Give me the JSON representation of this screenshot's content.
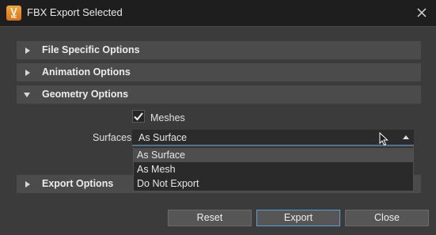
{
  "window": {
    "title": "FBX Export Selected",
    "app_icon_letter": "V",
    "app_icon_sub": "ME",
    "close_icon": "close-icon"
  },
  "sections": [
    {
      "label": "File Specific Options",
      "expanded": false
    },
    {
      "label": "Animation Options",
      "expanded": false
    },
    {
      "label": "Geometry Options",
      "expanded": true
    },
    {
      "label": "Export Options",
      "expanded": false
    }
  ],
  "geometry": {
    "meshes_label": "Meshes",
    "meshes_checked": true,
    "surfaces_label": "Surfaces",
    "surfaces_value": "As Surface",
    "surfaces_options": [
      "As Surface",
      "As Mesh",
      "Do Not Export"
    ],
    "selected_option_index": 0
  },
  "buttons": {
    "reset": "Reset",
    "export": "Export",
    "close": "Close"
  },
  "colors": {
    "accent": "#5aa0d8",
    "titlebar": "#1e1e1e",
    "app_icon": "#f3a531"
  }
}
